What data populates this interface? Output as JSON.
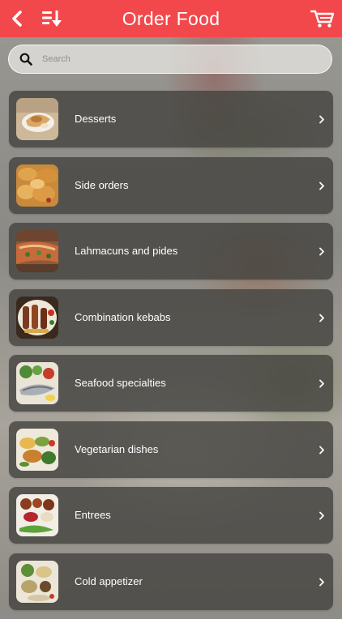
{
  "header": {
    "title": "Order Food",
    "background_color": "#f2484b",
    "back_icon": "back-arrow-icon",
    "sort_icon": "sort-list-icon",
    "cart_icon": "cart-icon"
  },
  "search": {
    "placeholder": "Search",
    "value": "",
    "icon": "search-icon"
  },
  "categories": [
    {
      "label": "Desserts",
      "icon": "desserts-thumbnail"
    },
    {
      "label": "Side orders",
      "icon": "side-orders-thumbnail"
    },
    {
      "label": "Lahmacuns and pides",
      "icon": "lahmacun-thumbnail"
    },
    {
      "label": "Combination kebabs",
      "icon": "kebab-thumbnail"
    },
    {
      "label": "Seafood specialties",
      "icon": "seafood-thumbnail"
    },
    {
      "label": "Vegetarian dishes",
      "icon": "vegetarian-thumbnail"
    },
    {
      "label": "Entrees",
      "icon": "entrees-thumbnail"
    },
    {
      "label": "Cold appetizer",
      "icon": "cold-appetizer-thumbnail"
    }
  ]
}
